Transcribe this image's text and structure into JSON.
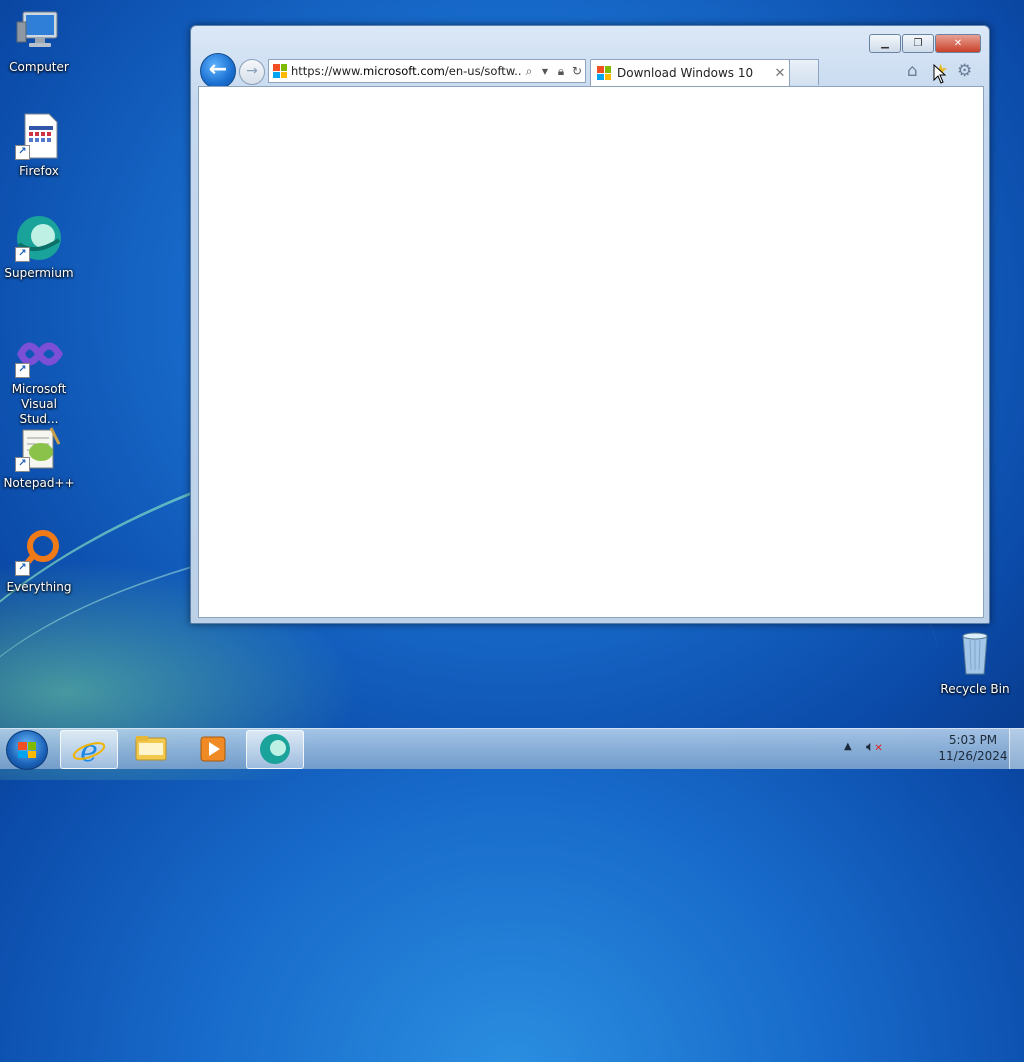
{
  "desktop": {
    "icons": [
      {
        "label": "Computer"
      },
      {
        "label": "Firefox"
      },
      {
        "label": "Supermium"
      },
      {
        "label": "Microsoft Visual Stud..."
      },
      {
        "label": "Notepad++"
      },
      {
        "label": "Everything"
      },
      {
        "label": "Recycle Bin"
      }
    ]
  },
  "browser": {
    "address": {
      "prefix": "https://www.",
      "domain": "microsoft.com",
      "path": "/en-us/softw..."
    },
    "tab": {
      "title": "Download Windows 10"
    },
    "icons": [
      "back-icon",
      "forward-icon",
      "search-icon",
      "lock-icon",
      "refresh-icon",
      "home-icon",
      "favorites-star-icon",
      "settings-gear-icon"
    ]
  },
  "taskbar": {
    "pinned": [
      "internet-explorer-icon",
      "file-explorer-icon",
      "media-player-icon",
      "supermium-icon"
    ],
    "clock": {
      "time": "5:03 PM",
      "date": "11/26/2024"
    }
  },
  "colors": {
    "microsoft_logo": [
      "#f25022",
      "#7fba00",
      "#00a4ef",
      "#ffb900"
    ],
    "desktop_blue": "#1769c9"
  }
}
